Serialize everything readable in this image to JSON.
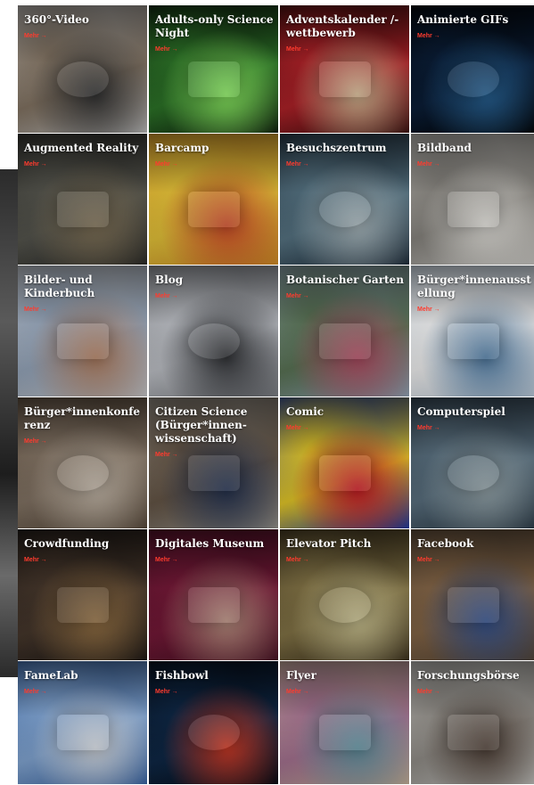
{
  "more_label": "Mehr →",
  "tiles": [
    {
      "title": "360°-Video",
      "colors": [
        "#cfcfcf",
        "#8a7a68",
        "#3a3a3a"
      ],
      "icon": "vr-headset-icon"
    },
    {
      "title": "Adults-only Science Night",
      "colors": [
        "#0c1a0c",
        "#2f7a2a",
        "#96ff6a"
      ],
      "icon": "light-arches-icon"
    },
    {
      "title": "Adventskalender /-wettbewerb",
      "colors": [
        "#3a0c0c",
        "#b8232a",
        "#e9c9a0"
      ],
      "icon": "calendar-icon"
    },
    {
      "title": "Animierte GIFs",
      "colors": [
        "#000000",
        "#0b1f3a",
        "#2b6aa0"
      ],
      "icon": "globe-icon"
    },
    {
      "title": "Augmented Reality",
      "colors": [
        "#2b2b28",
        "#5a5a52",
        "#8a7b5f"
      ],
      "icon": "sandbox-icon"
    },
    {
      "title": "Barcamp",
      "colors": [
        "#e39b2a",
        "#f2ce3c",
        "#e2552e"
      ],
      "icon": "sticky-notes-icon"
    },
    {
      "title": "Besuchszentrum",
      "colors": [
        "#1c2b3a",
        "#5b7a8a",
        "#b6c6cc"
      ],
      "icon": "showcase-icon"
    },
    {
      "title": "Bildband",
      "colors": [
        "#d9d7d2",
        "#8f8c86",
        "#f2f0ea"
      ],
      "icon": "book-icon"
    },
    {
      "title": "Bilder- und Kinderbuch",
      "colors": [
        "#d8dade",
        "#9fb0c6",
        "#c08a6a"
      ],
      "icon": "mug-icon"
    },
    {
      "title": "Blog",
      "colors": [
        "#8a8d93",
        "#c9ccd2",
        "#3a3c40"
      ],
      "icon": "laptop-icon"
    },
    {
      "title": "Botanischer Garten",
      "colors": [
        "#9fb6c9",
        "#5f7a5a",
        "#c2556e"
      ],
      "icon": "greenhouse-icon"
    },
    {
      "title": "Bürger*innenausstellung",
      "colors": [
        "#cfe0f0",
        "#ffffff",
        "#5a8ab6"
      ],
      "icon": "exhibition-icon"
    },
    {
      "title": "Bürger*innenkonferenz",
      "colors": [
        "#5a4a3a",
        "#8a7a6a",
        "#d1c4b4"
      ],
      "icon": "conference-icon"
    },
    {
      "title": "Citizen Science (Bürger*innen-wissenschaft)",
      "colors": [
        "#a6a29a",
        "#6a5a4a",
        "#2b3a5a"
      ],
      "icon": "binoculars-icon"
    },
    {
      "title": "Comic",
      "colors": [
        "#1b3fb0",
        "#f2d42a",
        "#e1202a"
      ],
      "icon": "pow-icon"
    },
    {
      "title": "Computerspiel",
      "colors": [
        "#2a3a48",
        "#5f7686",
        "#9fb0b6"
      ],
      "icon": "viking-icon"
    },
    {
      "title": "Crowdfunding",
      "colors": [
        "#1a1614",
        "#4a3a2e",
        "#a07a4a"
      ],
      "icon": "crowd-icon"
    },
    {
      "title": "Digitales Museum",
      "colors": [
        "#4a0f24",
        "#7a1a3a",
        "#c89a8a"
      ],
      "icon": "museum-icon"
    },
    {
      "title": "Elevator Pitch",
      "colors": [
        "#3a2e1a",
        "#8a7a4a",
        "#d8cf9a"
      ],
      "icon": "gauge-icon"
    },
    {
      "title": "Facebook",
      "colors": [
        "#5a4a3a",
        "#8a6a4a",
        "#3a5a9a"
      ],
      "icon": "phone-icon"
    },
    {
      "title": "FameLab",
      "colors": [
        "#3a6ab0",
        "#8ab0e0",
        "#e8eef6"
      ],
      "icon": "speaker-icon"
    },
    {
      "title": "Fishbowl",
      "colors": [
        "#050a14",
        "#0f2a4a",
        "#e2402a"
      ],
      "icon": "fish-icon"
    },
    {
      "title": "Flyer",
      "colors": [
        "#d8c0a6",
        "#b07a9a",
        "#6aa0b0"
      ],
      "icon": "paper-stack-icon"
    },
    {
      "title": "Forschungsbörse",
      "colors": [
        "#d6d6d2",
        "#9a9690",
        "#5a4a40"
      ],
      "icon": "laptop-user-icon"
    }
  ]
}
